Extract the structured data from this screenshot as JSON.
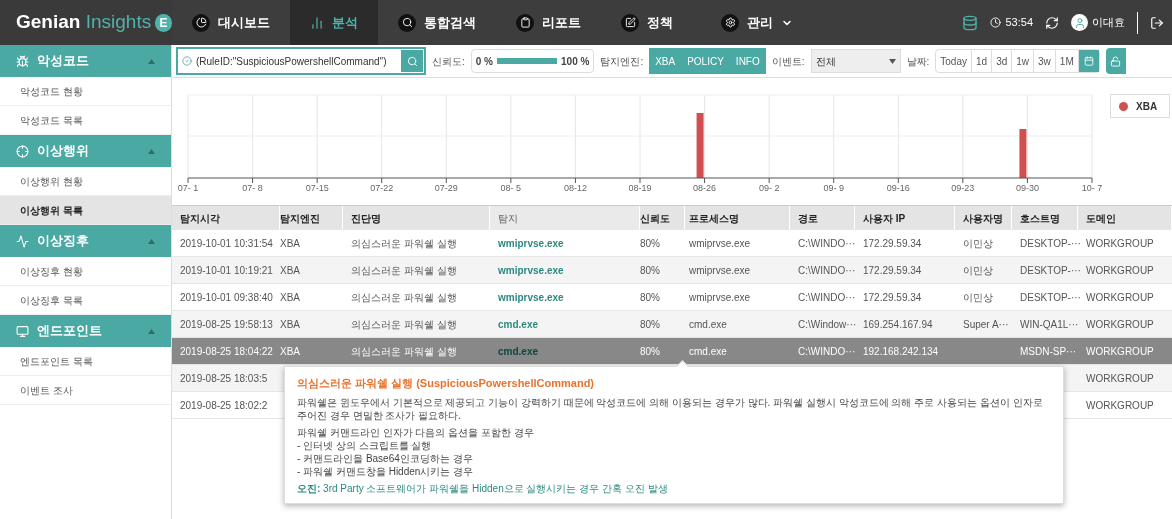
{
  "header": {
    "logo": {
      "brand": "Genian",
      "product": "Insights",
      "badge": "E"
    },
    "nav": [
      {
        "label": "대시보드",
        "kind": "dashboard",
        "selected": false,
        "has_menu": false
      },
      {
        "label": "분석",
        "kind": "analysis",
        "selected": true,
        "has_menu": false
      },
      {
        "label": "통합검색",
        "kind": "search",
        "selected": false,
        "has_menu": false
      },
      {
        "label": "리포트",
        "kind": "report",
        "selected": false,
        "has_menu": false
      },
      {
        "label": "정책",
        "kind": "policy",
        "selected": false,
        "has_menu": false
      },
      {
        "label": "관리",
        "kind": "admin",
        "selected": false,
        "has_menu": true
      }
    ],
    "timer": "53:54",
    "user": "이대효"
  },
  "sidebar": {
    "sections": [
      {
        "title": "악성코드",
        "kind": "malware",
        "expanded": true,
        "items": [
          {
            "label": "악성코드 현황",
            "selected": false
          },
          {
            "label": "악성코드 목록",
            "selected": false
          }
        ]
      },
      {
        "title": "이상행위",
        "kind": "anomaly",
        "expanded": true,
        "items": [
          {
            "label": "이상행위 현황",
            "selected": false
          },
          {
            "label": "이상행위 목록",
            "selected": true
          }
        ]
      },
      {
        "title": "이상징후",
        "kind": "signs",
        "expanded": true,
        "items": [
          {
            "label": "이상징후 현황",
            "selected": false
          },
          {
            "label": "이상징후 목록",
            "selected": false
          }
        ]
      },
      {
        "title": "엔드포인트",
        "kind": "endpoint",
        "expanded": true,
        "items": [
          {
            "label": "엔드포인트 목록",
            "selected": false
          },
          {
            "label": "이벤트 조사",
            "selected": false
          }
        ]
      }
    ]
  },
  "filters": {
    "query": "(RuleID:\"SuspiciousPowershellCommand\")",
    "confidence": {
      "label": "신뢰도:",
      "min": "0 %",
      "max": "100 %",
      "level": 1
    },
    "engines": {
      "label": "탐지엔진:",
      "options": [
        {
          "label": "XBA",
          "selected": true
        },
        {
          "label": "POLICY",
          "selected": true
        },
        {
          "label": "INFO",
          "selected": true
        }
      ]
    },
    "event": {
      "label": "이벤트:",
      "value": "전체"
    },
    "date": {
      "label": "날짜:",
      "options": [
        {
          "label": "Today",
          "selected": false
        },
        {
          "label": "1d",
          "selected": false
        },
        {
          "label": "3d",
          "selected": false
        },
        {
          "label": "1w",
          "selected": false
        },
        {
          "label": "3w",
          "selected": false
        },
        {
          "label": "1M",
          "selected": false
        }
      ]
    }
  },
  "chart": {
    "x_tick_labels": [
      "07- 1",
      "07- 8",
      "07-15",
      "07-22",
      "07-29",
      "08- 5",
      "08-12",
      "08-19",
      "08-26",
      "09- 2",
      "09- 9",
      "09-16",
      "09-23",
      "09-30",
      "10- 7"
    ],
    "legend": [
      {
        "label": "XBA",
        "color": "#d05050"
      }
    ]
  },
  "table": {
    "columns": [
      "탐지시각",
      "탐지엔진",
      "진단명",
      "탐지",
      "신뢰도",
      "프로세스명",
      "경로",
      "사용자 IP",
      "사용자명",
      "호스트명",
      "도메인"
    ],
    "rows": [
      {
        "selected": false,
        "cells": [
          "2019-10-01 10:31:54",
          "XBA",
          "의심스러운 파워쉘 실행",
          "wmiprvse.exe",
          "80%",
          "wmiprvse.exe",
          "C:\\WINDO···",
          "172.29.59.34",
          "이민상",
          "DESKTOP-···",
          "WORKGROUP"
        ]
      },
      {
        "selected": false,
        "cells": [
          "2019-10-01 10:19:21",
          "XBA",
          "의심스러운 파워쉘 실행",
          "wmiprvse.exe",
          "80%",
          "wmiprvse.exe",
          "C:\\WINDO···",
          "172.29.59.34",
          "이민상",
          "DESKTOP-···",
          "WORKGROUP"
        ]
      },
      {
        "selected": false,
        "cells": [
          "2019-10-01 09:38:40",
          "XBA",
          "의심스러운 파워쉘 실행",
          "wmiprvse.exe",
          "80%",
          "wmiprvse.exe",
          "C:\\WINDO···",
          "172.29.59.34",
          "이민상",
          "DESKTOP-···",
          "WORKGROUP"
        ]
      },
      {
        "selected": false,
        "cells": [
          "2019-08-25 19:58:13",
          "XBA",
          "의심스러운 파워쉘 실행",
          "cmd.exe",
          "80%",
          "cmd.exe",
          "C:\\Window···",
          "169.254.167.94",
          "Super A···",
          "WIN-QA1L···",
          "WORKGROUP"
        ]
      },
      {
        "selected": true,
        "cells": [
          "2019-08-25 18:04:22",
          "XBA",
          "의심스러운 파워쉘 실행",
          "cmd.exe",
          "80%",
          "cmd.exe",
          "C:\\WINDO···",
          "192.168.242.134",
          "",
          "MSDN-SP···",
          "WORKGROUP"
        ]
      },
      {
        "selected": false,
        "cells": [
          "2019-08-25 18:03:5",
          "",
          "",
          "",
          "",
          "",
          "",
          "",
          "",
          "",
          "WORKGROUP"
        ]
      },
      {
        "selected": false,
        "cells": [
          "2019-08-25 18:02:2",
          "",
          "",
          "",
          "",
          "",
          "",
          "",
          "",
          "",
          "WORKGROUP"
        ]
      }
    ]
  },
  "tooltip": {
    "title": "의심스러운 파워쉘 실행 (SuspiciousPowershellCommand)",
    "description": "파워쉘은 윈도우에서 기본적으로 제공되고 기능이 강력하기 때문에 악성코드에 의해 이용되는 경우가 많다. 파워쉘 실행시 악성코드에 의해 주로 사용되는 옵션이 인자로 주어진 경우 면밀한 조사가 필요하다.",
    "lines": [
      "파워쉘 커맨드라인 인자가 다음의 옵션을 포함한 경우",
      "- 인터넷 상의 스크립트를 실행",
      "- 커맨드라인을 Base64인코딩하는 경우",
      "- 파워쉘 커맨드창을 Hidden시키는 경우"
    ],
    "note": "**오진:** 3rd Party 소프트웨어가 파워쉘을 Hidden으로 실행시키는 경우 간혹 오진 발생"
  }
}
